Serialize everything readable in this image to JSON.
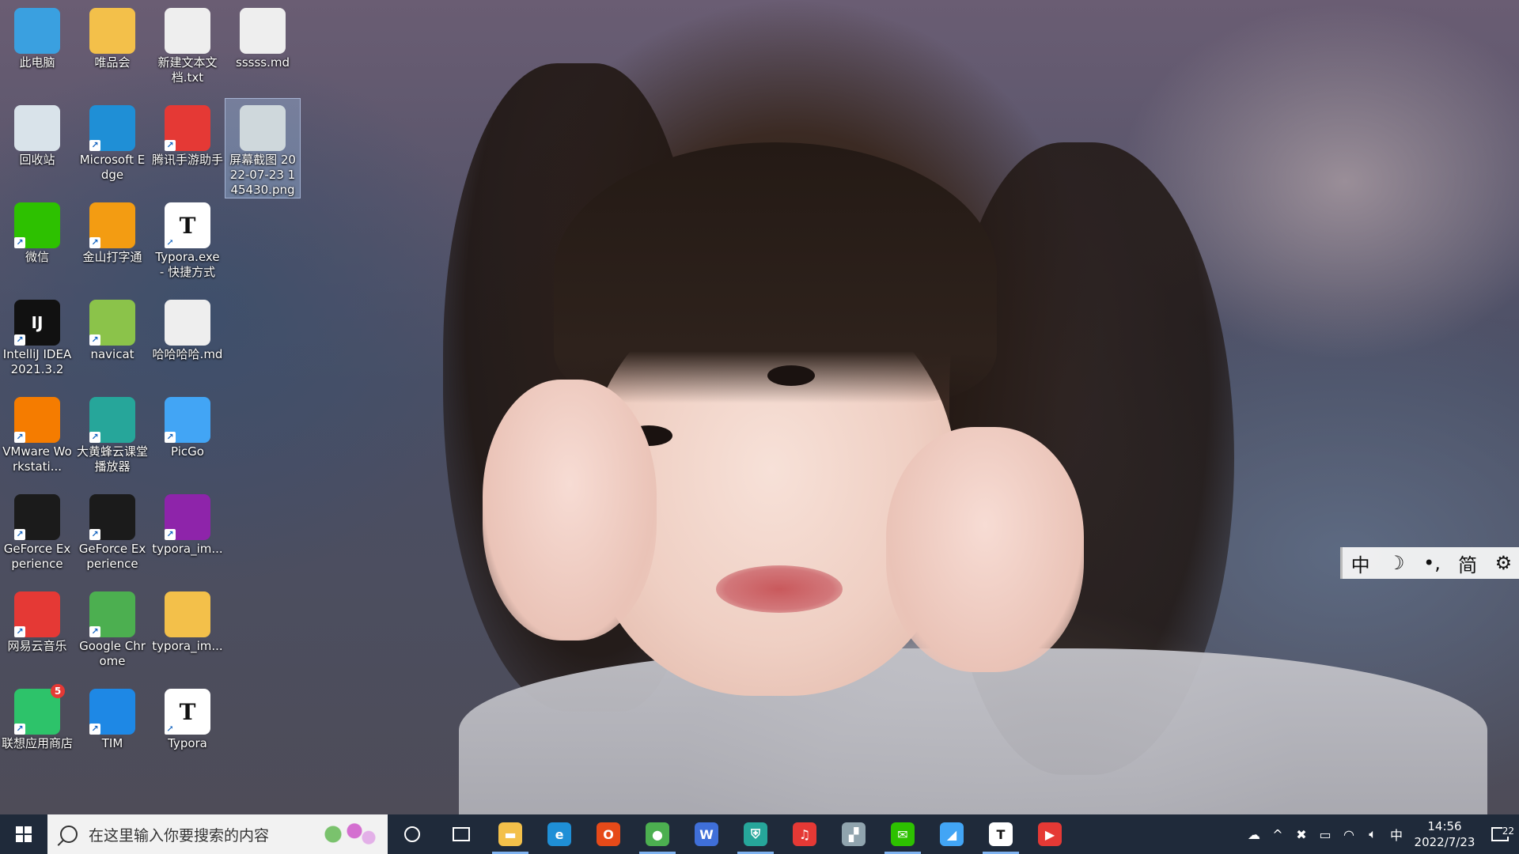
{
  "desktop": {
    "icons": [
      {
        "label": "此电脑",
        "icon": "this-pc-icon",
        "color": "#3aa0e0"
      },
      {
        "label": "唯品会",
        "icon": "folder-icon",
        "color": "#f3c04a"
      },
      {
        "label": "新建文本文档.txt",
        "icon": "text-file-icon",
        "color": "#eeeeee"
      },
      {
        "label": "sssss.md",
        "icon": "markdown-file-icon",
        "color": "#eeeeee"
      },
      {
        "label": "回收站",
        "icon": "recycle-bin-icon",
        "color": "#d9e3ea"
      },
      {
        "label": "Microsoft Edge",
        "icon": "edge-icon",
        "color": "#1f8fd6"
      },
      {
        "label": "腾讯手游助手",
        "icon": "tencent-game-assistant-icon",
        "color": "#e53935"
      },
      {
        "label": "屏幕截图 2022-07-23 145430.png",
        "icon": "image-file-icon",
        "color": "#cfd8dc"
      },
      {
        "label": "微信",
        "icon": "wechat-icon",
        "color": "#2dc100"
      },
      {
        "label": "金山打字通",
        "icon": "kingsoft-typing-icon",
        "color": "#f39c12"
      },
      {
        "label": "Typora.exe - 快捷方式",
        "icon": "typora-icon",
        "color": "#ffffff"
      },
      {
        "label": "IntelliJ IDEA 2021.3.2",
        "icon": "intellij-idea-icon",
        "color": "#111111"
      },
      {
        "label": "navicat",
        "icon": "navicat-icon",
        "color": "#8bc34a"
      },
      {
        "label": "哈哈哈哈.md",
        "icon": "markdown-file-icon",
        "color": "#eeeeee"
      },
      {
        "label": "VMware Workstati...",
        "icon": "vmware-icon",
        "color": "#f57c00"
      },
      {
        "label": "大黄蜂云课堂播放器",
        "icon": "hornet-player-icon",
        "color": "#26a69a"
      },
      {
        "label": "PicGo",
        "icon": "picgo-icon",
        "color": "#42a5f5"
      },
      {
        "label": "GeForce Experience",
        "icon": "geforce-icon",
        "color": "#1b1b1b"
      },
      {
        "label": "GeForce Experience",
        "icon": "geforce-icon",
        "color": "#1b1b1b"
      },
      {
        "label": "typora_im...",
        "icon": "winrar-archive-icon",
        "color": "#8e24aa"
      },
      {
        "label": "网易云音乐",
        "icon": "netease-music-icon",
        "color": "#e53935"
      },
      {
        "label": "Google Chrome",
        "icon": "chrome-icon",
        "color": "#4caf50"
      },
      {
        "label": "typora_im...",
        "icon": "folder-icon",
        "color": "#f3c04a"
      },
      {
        "label": "联想应用商店",
        "icon": "lenovo-app-store-icon",
        "color": "#2dc36a",
        "badge": "5"
      },
      {
        "label": "TIM",
        "icon": "tim-icon",
        "color": "#1e88e5"
      },
      {
        "label": "Typora",
        "icon": "typora-icon",
        "color": "#ffffff"
      }
    ]
  },
  "ime": {
    "mode": "中",
    "moon": "☽",
    "punct": "•,",
    "charset": "简",
    "settings": "⚙"
  },
  "taskbar": {
    "search_placeholder": "在这里输入你要搜索的内容",
    "apps": [
      {
        "name": "file-explorer",
        "glyph": "▬",
        "color": "#f3c04a",
        "open": true
      },
      {
        "name": "edge",
        "glyph": "e",
        "color": "#1f8fd6",
        "open": false
      },
      {
        "name": "office",
        "glyph": "O",
        "color": "#e64a19",
        "open": false
      },
      {
        "name": "chrome",
        "glyph": "●",
        "color": "#4caf50",
        "open": true
      },
      {
        "name": "wps-writer",
        "glyph": "W",
        "color": "#3f6fd8",
        "open": false
      },
      {
        "name": "hornet-player",
        "glyph": "⛨",
        "color": "#26a69a",
        "open": true
      },
      {
        "name": "netease-music",
        "glyph": "♫",
        "color": "#e53935",
        "open": false
      },
      {
        "name": "notes-app",
        "glyph": "▞",
        "color": "#90a4ae",
        "open": false
      },
      {
        "name": "wechat",
        "glyph": "✉",
        "color": "#2dc100",
        "open": true
      },
      {
        "name": "picgo",
        "glyph": "◢",
        "color": "#42a5f5",
        "open": false
      },
      {
        "name": "typora",
        "glyph": "T",
        "color": "#ffffff",
        "open": true
      },
      {
        "name": "iqiyi",
        "glyph": "▶",
        "color": "#e53935",
        "open": false
      }
    ],
    "tray": {
      "weather": "☁",
      "chevron": "^",
      "ime_indicator": "中",
      "time": "14:56",
      "date": "2022/7/23",
      "notifications": "22"
    }
  }
}
